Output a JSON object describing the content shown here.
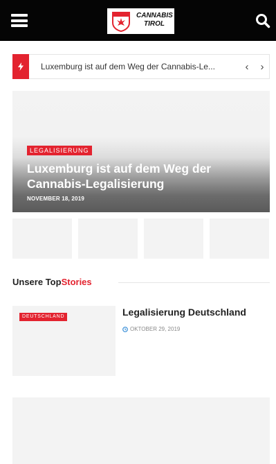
{
  "header": {
    "logo": {
      "line1": "CANNABIS",
      "line2": "TIROL"
    },
    "colors": {
      "bar": "#050505",
      "accent": "#e3232f"
    },
    "icons": {
      "menu": "hamburger-menu-icon",
      "search": "search-icon",
      "logo": "shield-logo-icon"
    }
  },
  "ticker": {
    "text": "Luxemburg ist auf dem Weg der Cannabis-Le...",
    "prev": "‹",
    "next": "›",
    "icons": {
      "flash": "lightning-icon"
    }
  },
  "hero": {
    "category": "LEGALISIERUNG",
    "title": "Luxemburg ist auf dem Weg der Cannabis-Legalisierung",
    "date": "NOVEMBER 18, 2019"
  },
  "section": {
    "title_prefix": "Unsere Top",
    "title_accent": "Stories"
  },
  "stories": [
    {
      "category": "DEUTSCHLAND",
      "title": "Legalisierung Deutschland",
      "date": "OKTOBER 29, 2019"
    }
  ]
}
